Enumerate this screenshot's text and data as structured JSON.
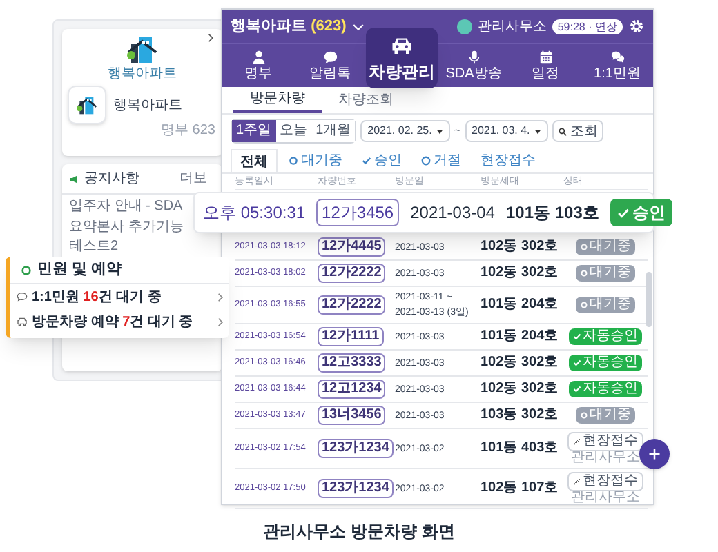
{
  "side_panel": {
    "logo_text": "행복아파트",
    "complex_name": "행복아파트",
    "member_count": "명부 623",
    "notice": {
      "title": "공지사항",
      "more": "더보",
      "lines": [
        "입주자 안내 - SDA",
        "요약본사 추가기능",
        "테스트2"
      ]
    }
  },
  "header": {
    "title": "행복아파트",
    "count": "(623)",
    "user": "관리사무소",
    "session": "59:28 · 연장"
  },
  "nav": [
    {
      "label": "명부",
      "selected": false
    },
    {
      "label": "알림톡",
      "selected": false
    },
    {
      "label": "차량관리",
      "selected": true
    },
    {
      "label": "SDA방송",
      "selected": false
    },
    {
      "label": "일정",
      "selected": false
    },
    {
      "label": "1:1민원",
      "selected": false
    }
  ],
  "sub_tabs": [
    {
      "label": "방문차량",
      "selected": true
    },
    {
      "label": "차량조회",
      "selected": false
    }
  ],
  "period_buttons": [
    {
      "label": "1주일",
      "selected": true
    },
    {
      "label": "오늘",
      "selected": false
    },
    {
      "label": "1개월",
      "selected": false
    }
  ],
  "date_from": "2021. 02. 25.",
  "date_sep": "~",
  "date_to": "2021. 03. 4.",
  "search_button": "조회",
  "status_tabs": [
    {
      "label": "전체",
      "selected": true
    },
    {
      "label": "대기중",
      "selected": false
    },
    {
      "label": "승인",
      "selected": false
    },
    {
      "label": "거절",
      "selected": false
    },
    {
      "label": "현장접수",
      "selected": false
    }
  ],
  "table": {
    "columns": [
      "등록일시",
      "차량번호",
      "방문일",
      "방문세대",
      "상태"
    ],
    "rows": [
      {
        "time": "2021-03-03 18:12",
        "plate": "12가4445",
        "date": [
          "2021-03-03"
        ],
        "unit": "102동 302호",
        "status": {
          "kind": "waiting",
          "label": "대기중"
        }
      },
      {
        "time": "2021-03-03 18:02",
        "plate": "12가2222",
        "date": [
          "2021-03-03"
        ],
        "unit": "102동 302호",
        "status": {
          "kind": "waiting",
          "label": "대기중"
        }
      },
      {
        "time": "2021-03-03 16:55",
        "plate": "12가2222",
        "date": [
          "2021-03-11 ~",
          "2021-03-13 (3일)"
        ],
        "unit": "101동 204호",
        "status": {
          "kind": "waiting",
          "label": "대기중"
        }
      },
      {
        "time": "2021-03-03 16:54",
        "plate": "12가1111",
        "date": [
          "2021-03-03"
        ],
        "unit": "101동 204호",
        "status": {
          "kind": "auto",
          "label": "자동승인"
        }
      },
      {
        "time": "2021-03-03 16:46",
        "plate": "12고3333",
        "date": [
          "2021-03-03"
        ],
        "unit": "102동 302호",
        "status": {
          "kind": "auto",
          "label": "자동승인"
        }
      },
      {
        "time": "2021-03-03 16:44",
        "plate": "12고1234",
        "date": [
          "2021-03-03"
        ],
        "unit": "102동 302호",
        "status": {
          "kind": "auto",
          "label": "자동승인"
        }
      },
      {
        "time": "2021-03-03 13:47",
        "plate": "13너3456",
        "date": [
          "2021-03-03"
        ],
        "unit": "103동 302호",
        "status": {
          "kind": "waiting",
          "label": "대기중"
        }
      },
      {
        "time": "2021-03-02 17:54",
        "plate": "123가1234",
        "date": [
          "2021-03-02"
        ],
        "unit": "101동 403호",
        "status": {
          "kind": "onsite",
          "label": "현장접수",
          "by": "관리사무소"
        }
      },
      {
        "time": "2021-03-02 17:50",
        "plate": "123가1234",
        "date": [
          "2021-03-02"
        ],
        "unit": "102동 107호",
        "status": {
          "kind": "onsite",
          "label": "현장접수",
          "by": "관리사무소"
        }
      }
    ]
  },
  "highlight_row": {
    "time": "오후 05:30:31",
    "plate": "12가3456",
    "date": "2021-03-04",
    "unit": "101동 103호",
    "action": "승인"
  },
  "requests_card": {
    "title": "민원 및 예약",
    "items": [
      {
        "before": "1:1민원 ",
        "count": "16",
        "after": "건 대기 중"
      },
      {
        "before": "방문차량 예약 ",
        "count": "7",
        "after": "건 대기 중"
      }
    ]
  },
  "caption": "관리사무소 방문차량 화면"
}
